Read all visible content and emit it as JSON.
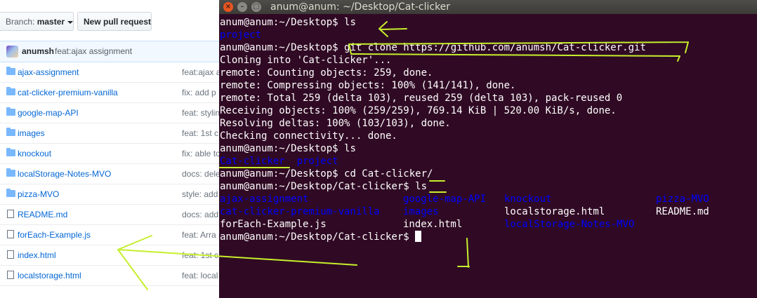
{
  "github": {
    "branch_prefix": "Branch:",
    "branch_value": "master",
    "new_pull_request": "New pull request",
    "commit_author": "anumsh",
    "commit_message": "feat:ajax assignment",
    "files": [
      {
        "name": "ajax-assignment",
        "type": "folder",
        "message": "feat:ajax a"
      },
      {
        "name": "cat-clicker-premium-vanilla",
        "type": "folder",
        "message": "fix: add p"
      },
      {
        "name": "google-map-API",
        "type": "folder",
        "message": "feat: stylin"
      },
      {
        "name": "images",
        "type": "folder",
        "message": "feat: 1st c"
      },
      {
        "name": "knockout",
        "type": "folder",
        "message": "fix: able to"
      },
      {
        "name": "localStorage-Notes-MVO",
        "type": "folder",
        "message": "docs: dele"
      },
      {
        "name": "pizza-MVO",
        "type": "folder",
        "message": "style: add"
      },
      {
        "name": "README.md",
        "type": "file",
        "message": "docs: add"
      },
      {
        "name": "forEach-Example.js",
        "type": "file",
        "message": "feat: Arra"
      },
      {
        "name": "index.html",
        "type": "file",
        "message": "feat: 1st c"
      },
      {
        "name": "localstorage.html",
        "type": "file",
        "message": "feat: local"
      }
    ]
  },
  "terminal": {
    "title": "anum@anum: ~/Desktop/Cat-clicker",
    "close_glyph": "×",
    "min_glyph": "–",
    "max_glyph": "□",
    "lines": [
      {
        "prompt": "anum@anum:~/Desktop$ ",
        "cmd": "ls"
      },
      {
        "out_blue": "project"
      },
      {
        "prompt": "anum@anum:~/Desktop$ ",
        "cmd": "git clone https://github.com/anumsh/Cat-clicker.git"
      },
      {
        "out": "Cloning into 'Cat-clicker'..."
      },
      {
        "out": "remote: Counting objects: 259, done."
      },
      {
        "out": "remote: Compressing objects: 100% (141/141), done."
      },
      {
        "out": "remote: Total 259 (delta 103), reused 259 (delta 103), pack-reused 0"
      },
      {
        "out": "Receiving objects: 100% (259/259), 769.14 KiB | 520.00 KiB/s, done."
      },
      {
        "out": "Resolving deltas: 100% (103/103), done."
      },
      {
        "out": "Checking connectivity... done."
      },
      {
        "prompt": "anum@anum:~/Desktop$ ",
        "cmd": "ls"
      }
    ],
    "ls1_items": [
      "Cat-clicker",
      "project"
    ],
    "cd_line": {
      "prompt": "anum@anum:~/Desktop$ ",
      "cmd": "cd Cat-clicker/"
    },
    "ls2_line": {
      "prompt": "anum@anum:~/Desktop/Cat-clicker$ ",
      "cmd": "ls"
    },
    "grid": [
      [
        {
          "t": "ajax-assignment",
          "dir": true
        },
        {
          "t": "google-map-API",
          "dir": true
        },
        {
          "t": "knockout",
          "dir": true
        },
        {
          "t": "pizza-MVO",
          "dir": true
        }
      ],
      [
        {
          "t": "cat-clicker-premium-vanilla",
          "dir": true
        },
        {
          "t": "images",
          "dir": true
        },
        {
          "t": "localstorage.html",
          "dir": false
        },
        {
          "t": "README.md",
          "dir": false
        }
      ],
      [
        {
          "t": "forEach-Example.js",
          "dir": false
        },
        {
          "t": "index.html",
          "dir": false
        },
        {
          "t": "localStorage-Notes-MVO",
          "dir": true
        }
      ]
    ],
    "final_prompt": "anum@anum:~/Desktop/Cat-clicker$ "
  }
}
